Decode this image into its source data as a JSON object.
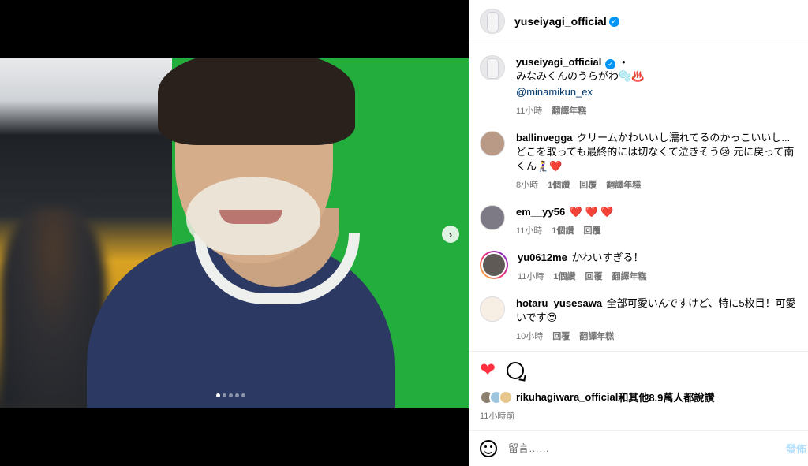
{
  "post": {
    "username": "yuseiyagi_official",
    "separator": "•",
    "caption_text": "みなみくんのうらがわ🫧♨️",
    "caption_mention": "@minamikun_ex",
    "caption_time": "11小時",
    "translate_label": "翻譯年糕",
    "image_index": 1,
    "image_count": 5,
    "next_icon": "chevron-right-icon"
  },
  "comments": [
    {
      "user": "ballinvegga",
      "text": "クリームかわいいし濡れてるのかっこいいし...どこを取っても最終的には切なくて泣きそう😢 元に戻って南くん🧎‍♀️❤️",
      "time": "8小時",
      "likes": "1個讚",
      "reply": "回覆",
      "translate": "翻譯年糕"
    },
    {
      "user": "em__yy56",
      "text": "❤️ ❤️ ❤️",
      "time": "11小時",
      "likes": "1個讚",
      "reply": "回覆",
      "translate": ""
    },
    {
      "user": "yu0612me",
      "text": "かわいすぎる！",
      "time": "11小時",
      "likes": "1個讚",
      "reply": "回覆",
      "translate": "翻譯年糕"
    },
    {
      "user": "hotaru_yusesawa",
      "text": "全部可愛いんですけど、特に5枚目！可愛いです😍",
      "time": "10小時",
      "likes": "",
      "reply": "回覆",
      "translate": "翻譯年糕"
    }
  ],
  "likes_line": {
    "user": "rikuhagiwara_official",
    "rest": "和其他8.9萬人都說讚"
  },
  "posted_time": "11小時前",
  "composer": {
    "placeholder": "留言……",
    "post_label": "發佈"
  },
  "colors": {
    "verified": "#0095f6",
    "like_red": "#ff3040",
    "mention": "#00376b"
  }
}
